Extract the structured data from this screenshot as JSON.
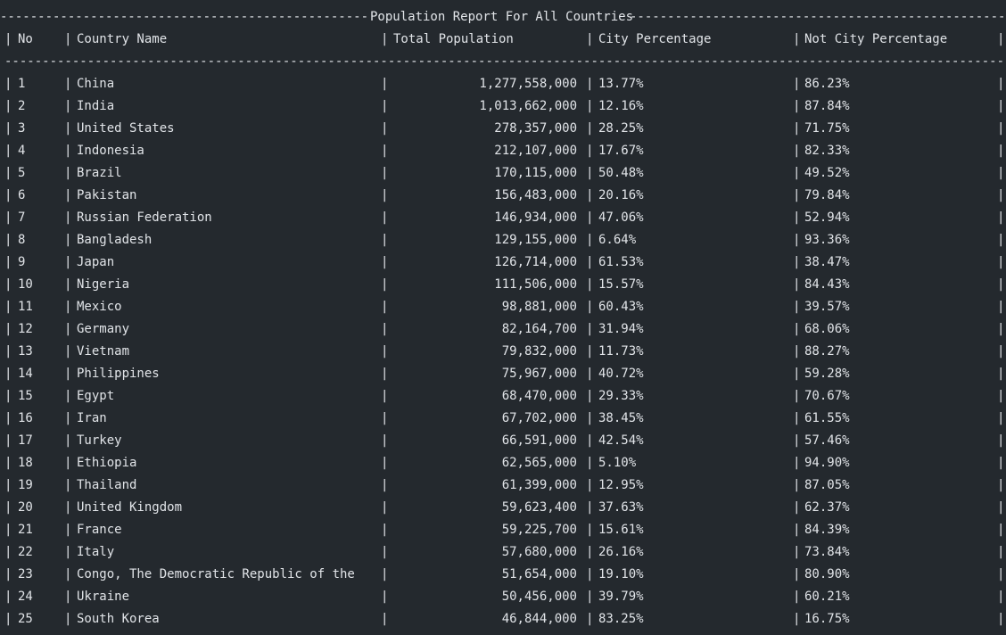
{
  "report": {
    "title": "Population Report For All Countries",
    "columns": [
      "No",
      "Country Name",
      "Total Population",
      "City Percentage",
      "Not City Percentage"
    ],
    "rows": [
      [
        "1",
        "China",
        "1,277,558,000",
        "13.77%",
        "86.23%"
      ],
      [
        "2",
        "India",
        "1,013,662,000",
        "12.16%",
        "87.84%"
      ],
      [
        "3",
        "United States",
        "278,357,000",
        "28.25%",
        "71.75%"
      ],
      [
        "4",
        "Indonesia",
        "212,107,000",
        "17.67%",
        "82.33%"
      ],
      [
        "5",
        "Brazil",
        "170,115,000",
        "50.48%",
        "49.52%"
      ],
      [
        "6",
        "Pakistan",
        "156,483,000",
        "20.16%",
        "79.84%"
      ],
      [
        "7",
        "Russian Federation",
        "146,934,000",
        "47.06%",
        "52.94%"
      ],
      [
        "8",
        "Bangladesh",
        "129,155,000",
        "6.64%",
        "93.36%"
      ],
      [
        "9",
        "Japan",
        "126,714,000",
        "61.53%",
        "38.47%"
      ],
      [
        "10",
        "Nigeria",
        "111,506,000",
        "15.57%",
        "84.43%"
      ],
      [
        "11",
        "Mexico",
        "98,881,000",
        "60.43%",
        "39.57%"
      ],
      [
        "12",
        "Germany",
        "82,164,700",
        "31.94%",
        "68.06%"
      ],
      [
        "13",
        "Vietnam",
        "79,832,000",
        "11.73%",
        "88.27%"
      ],
      [
        "14",
        "Philippines",
        "75,967,000",
        "40.72%",
        "59.28%"
      ],
      [
        "15",
        "Egypt",
        "68,470,000",
        "29.33%",
        "70.67%"
      ],
      [
        "16",
        "Iran",
        "67,702,000",
        "38.45%",
        "61.55%"
      ],
      [
        "17",
        "Turkey",
        "66,591,000",
        "42.54%",
        "57.46%"
      ],
      [
        "18",
        "Ethiopia",
        "62,565,000",
        "5.10%",
        "94.90%"
      ],
      [
        "19",
        "Thailand",
        "61,399,000",
        "12.95%",
        "87.05%"
      ],
      [
        "20",
        "United Kingdom",
        "59,623,400",
        "37.63%",
        "62.37%"
      ],
      [
        "21",
        "France",
        "59,225,700",
        "15.61%",
        "84.39%"
      ],
      [
        "22",
        "Italy",
        "57,680,000",
        "26.16%",
        "73.84%"
      ],
      [
        "23",
        "Congo, The Democratic Republic of the",
        "51,654,000",
        "19.10%",
        "80.90%"
      ],
      [
        "24",
        "Ukraine",
        "50,456,000",
        "39.79%",
        "60.21%"
      ],
      [
        "25",
        "South Korea",
        "46,844,000",
        "83.25%",
        "16.75%"
      ]
    ]
  },
  "colors": {
    "background": "#24292e",
    "text": "#e1e4e8"
  }
}
